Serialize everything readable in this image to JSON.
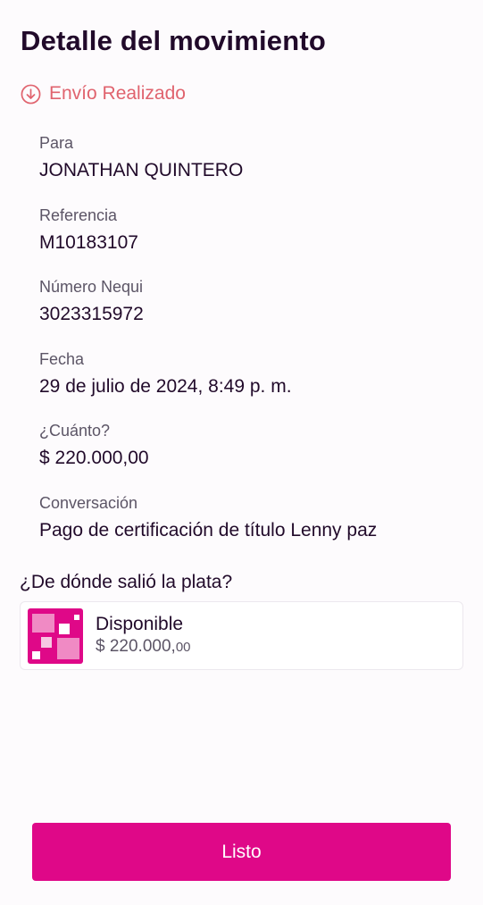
{
  "header": {
    "title": "Detalle del movimiento"
  },
  "status": {
    "icon": "arrow-down-circle-icon",
    "label": "Envío Realizado",
    "color": "#e0636e"
  },
  "details": {
    "para": {
      "label": "Para",
      "value": "JONATHAN QUINTERO"
    },
    "referencia": {
      "label": "Referencia",
      "value": "M10183107"
    },
    "numero": {
      "label": "Número Nequi",
      "value": "3023315972"
    },
    "fecha": {
      "label": "Fecha",
      "value": "29 de julio de 2024, 8:49 p. m."
    },
    "cuanto": {
      "label": "¿Cuánto?",
      "value": "$ 220.000,00"
    },
    "conversacion": {
      "label": "Conversación",
      "value": "Pago de certificación de título Lenny paz"
    }
  },
  "source": {
    "question": "¿De dónde salió la plata?",
    "icon": "nequi-disponible-icon",
    "name": "Disponible",
    "amount_main": "$ 220.000,",
    "amount_cents": "00"
  },
  "actions": {
    "done_label": "Listo",
    "accent": "#df0888"
  }
}
